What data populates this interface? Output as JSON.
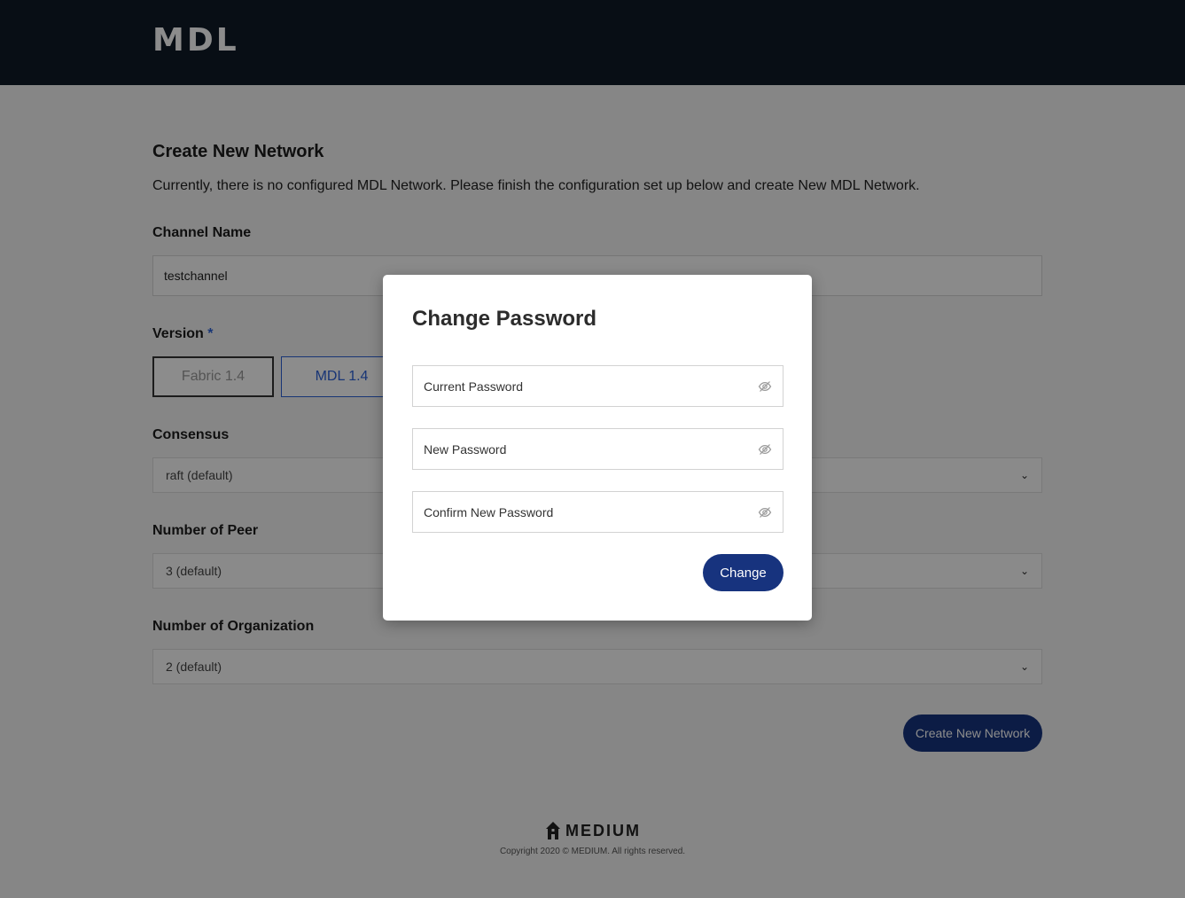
{
  "header": {
    "logo_text": "MDL"
  },
  "page": {
    "title": "Create New Network",
    "description": "Currently, there is no configured MDL Network. Please finish the configuration set up below and create New MDL Network."
  },
  "form": {
    "channel_name": {
      "label": "Channel Name",
      "value": "testchannel"
    },
    "version": {
      "label": "Version",
      "required_mark": "*",
      "options": [
        "Fabric 1.4",
        "MDL 1.4"
      ],
      "selected": "MDL 1.4"
    },
    "consensus": {
      "label": "Consensus",
      "value": "raft (default)"
    },
    "peers": {
      "label": "Number of Peer",
      "value": "3 (default)"
    },
    "organizations": {
      "label": "Number of Organization",
      "value": "2 (default)"
    },
    "submit_label": "Create New Network"
  },
  "footer": {
    "brand": "MEDIUM",
    "copyright": "Copyright 2020 © MEDIUM. All rights reserved."
  },
  "modal": {
    "title": "Change Password",
    "fields": [
      {
        "placeholder": "Current Password",
        "icon": "eye-off-icon"
      },
      {
        "placeholder": "New Password",
        "icon": "eye-off-icon"
      },
      {
        "placeholder": "Confirm New Password",
        "icon": "eye-off-icon"
      }
    ],
    "submit_label": "Change"
  },
  "colors": {
    "header_bg": "#0f1a27",
    "accent_blue": "#2d62d8",
    "button_navy": "#17337e"
  }
}
